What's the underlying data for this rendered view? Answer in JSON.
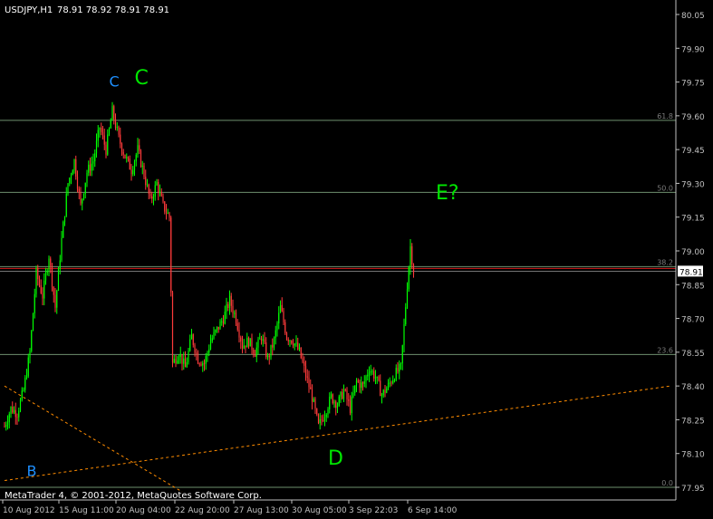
{
  "header": {
    "symbol": "USDJPY,H1",
    "ohlc": "78.91 78.92 78.91 78.91"
  },
  "footer": {
    "copyright": "MetaTrader 4, © 2001-2012, MetaQuotes Software Corp."
  },
  "colors": {
    "background": "#000000",
    "axis": "#c0c0c0",
    "bull": "#00ff00",
    "bear": "#ff3b3b",
    "fib": "#6e8f6e",
    "trendline": "#ff8c00",
    "current_price_line": "#d81c1c",
    "wave_label_green": "#00e600",
    "wave_label_blue": "#1e90ff",
    "price_box": "#ffffff"
  },
  "chart_data": {
    "type": "candlestick",
    "symbol": "USDJPY",
    "timeframe": "H1",
    "ylim": [
      77.95,
      80.05
    ],
    "y_ticks": [
      "80.05",
      "79.90",
      "79.75",
      "79.60",
      "79.45",
      "79.30",
      "79.15",
      "79.00",
      "78.85",
      "78.70",
      "78.55",
      "78.40",
      "78.25",
      "78.10",
      "77.95"
    ],
    "x_ticks": [
      "10 Aug 2012",
      "15 Aug 11:00",
      "20 Aug 04:00",
      "22 Aug 20:00",
      "27 Aug 13:00",
      "30 Aug 05:00",
      "3 Sep 22:03",
      "6 Sep 14:00"
    ],
    "current_price": 78.91,
    "current_price_label": "78.91",
    "fib_levels": [
      {
        "label": "61.8",
        "price": 79.58
      },
      {
        "label": "50.0",
        "price": 79.26
      },
      {
        "label": "38.2",
        "price": 78.93
      },
      {
        "label": "23.6",
        "price": 78.54
      },
      {
        "label": "0.0",
        "price": 77.95
      }
    ],
    "price_path": [
      {
        "bar": 0,
        "price": 78.22
      },
      {
        "bar": 4,
        "price": 78.3
      },
      {
        "bar": 8,
        "price": 78.28
      },
      {
        "bar": 12,
        "price": 78.38
      },
      {
        "bar": 16,
        "price": 78.55
      },
      {
        "bar": 20,
        "price": 78.9
      },
      {
        "bar": 24,
        "price": 78.8
      },
      {
        "bar": 28,
        "price": 78.98
      },
      {
        "bar": 32,
        "price": 78.75
      },
      {
        "bar": 36,
        "price": 79.05
      },
      {
        "bar": 40,
        "price": 79.3
      },
      {
        "bar": 44,
        "price": 79.4
      },
      {
        "bar": 48,
        "price": 79.2
      },
      {
        "bar": 52,
        "price": 79.35
      },
      {
        "bar": 56,
        "price": 79.4
      },
      {
        "bar": 60,
        "price": 79.55
      },
      {
        "bar": 64,
        "price": 79.45
      },
      {
        "bar": 68,
        "price": 79.62
      },
      {
        "bar": 72,
        "price": 79.5
      },
      {
        "bar": 76,
        "price": 79.42
      },
      {
        "bar": 80,
        "price": 79.36
      },
      {
        "bar": 84,
        "price": 79.45
      },
      {
        "bar": 88,
        "price": 79.34
      },
      {
        "bar": 92,
        "price": 79.22
      },
      {
        "bar": 96,
        "price": 79.3
      },
      {
        "bar": 100,
        "price": 79.2
      },
      {
        "bar": 104,
        "price": 79.15
      },
      {
        "bar": 106,
        "price": 78.5
      },
      {
        "bar": 110,
        "price": 78.55
      },
      {
        "bar": 114,
        "price": 78.48
      },
      {
        "bar": 118,
        "price": 78.62
      },
      {
        "bar": 122,
        "price": 78.52
      },
      {
        "bar": 126,
        "price": 78.5
      },
      {
        "bar": 130,
        "price": 78.6
      },
      {
        "bar": 134,
        "price": 78.65
      },
      {
        "bar": 138,
        "price": 78.7
      },
      {
        "bar": 142,
        "price": 78.78
      },
      {
        "bar": 146,
        "price": 78.7
      },
      {
        "bar": 150,
        "price": 78.58
      },
      {
        "bar": 154,
        "price": 78.6
      },
      {
        "bar": 158,
        "price": 78.55
      },
      {
        "bar": 162,
        "price": 78.62
      },
      {
        "bar": 166,
        "price": 78.52
      },
      {
        "bar": 170,
        "price": 78.6
      },
      {
        "bar": 174,
        "price": 78.75
      },
      {
        "bar": 178,
        "price": 78.62
      },
      {
        "bar": 182,
        "price": 78.6
      },
      {
        "bar": 186,
        "price": 78.55
      },
      {
        "bar": 190,
        "price": 78.45
      },
      {
        "bar": 194,
        "price": 78.35
      },
      {
        "bar": 198,
        "price": 78.22
      },
      {
        "bar": 202,
        "price": 78.28
      },
      {
        "bar": 206,
        "price": 78.35
      },
      {
        "bar": 210,
        "price": 78.32
      },
      {
        "bar": 214,
        "price": 78.38
      },
      {
        "bar": 218,
        "price": 78.3
      },
      {
        "bar": 222,
        "price": 78.42
      },
      {
        "bar": 226,
        "price": 78.4
      },
      {
        "bar": 230,
        "price": 78.48
      },
      {
        "bar": 234,
        "price": 78.44
      },
      {
        "bar": 238,
        "price": 78.36
      },
      {
        "bar": 242,
        "price": 78.4
      },
      {
        "bar": 246,
        "price": 78.45
      },
      {
        "bar": 250,
        "price": 78.48
      },
      {
        "bar": 254,
        "price": 78.85
      },
      {
        "bar": 256,
        "price": 79.02
      },
      {
        "bar": 258,
        "price": 78.91
      }
    ],
    "trendlines": [
      {
        "from": {
          "bar": 0,
          "price": 77.98
        },
        "to": {
          "bar": 420,
          "price": 78.4
        },
        "style": "dotted"
      },
      {
        "from": {
          "bar": 0,
          "price": 78.4
        },
        "to": {
          "bar": 112,
          "price": 77.93
        },
        "style": "dotted"
      }
    ],
    "wave_labels": [
      {
        "text": "C",
        "color": "blue",
        "bar": 66,
        "price": 79.73
      },
      {
        "text": "C",
        "color": "green",
        "bar": 82,
        "price": 79.74
      },
      {
        "text": "B",
        "color": "blue",
        "bar": 14,
        "price": 78.0
      },
      {
        "text": "D",
        "color": "green",
        "bar": 204,
        "price": 78.05
      },
      {
        "text": "E?",
        "color": "green",
        "bar": 272,
        "price": 79.23
      }
    ]
  }
}
